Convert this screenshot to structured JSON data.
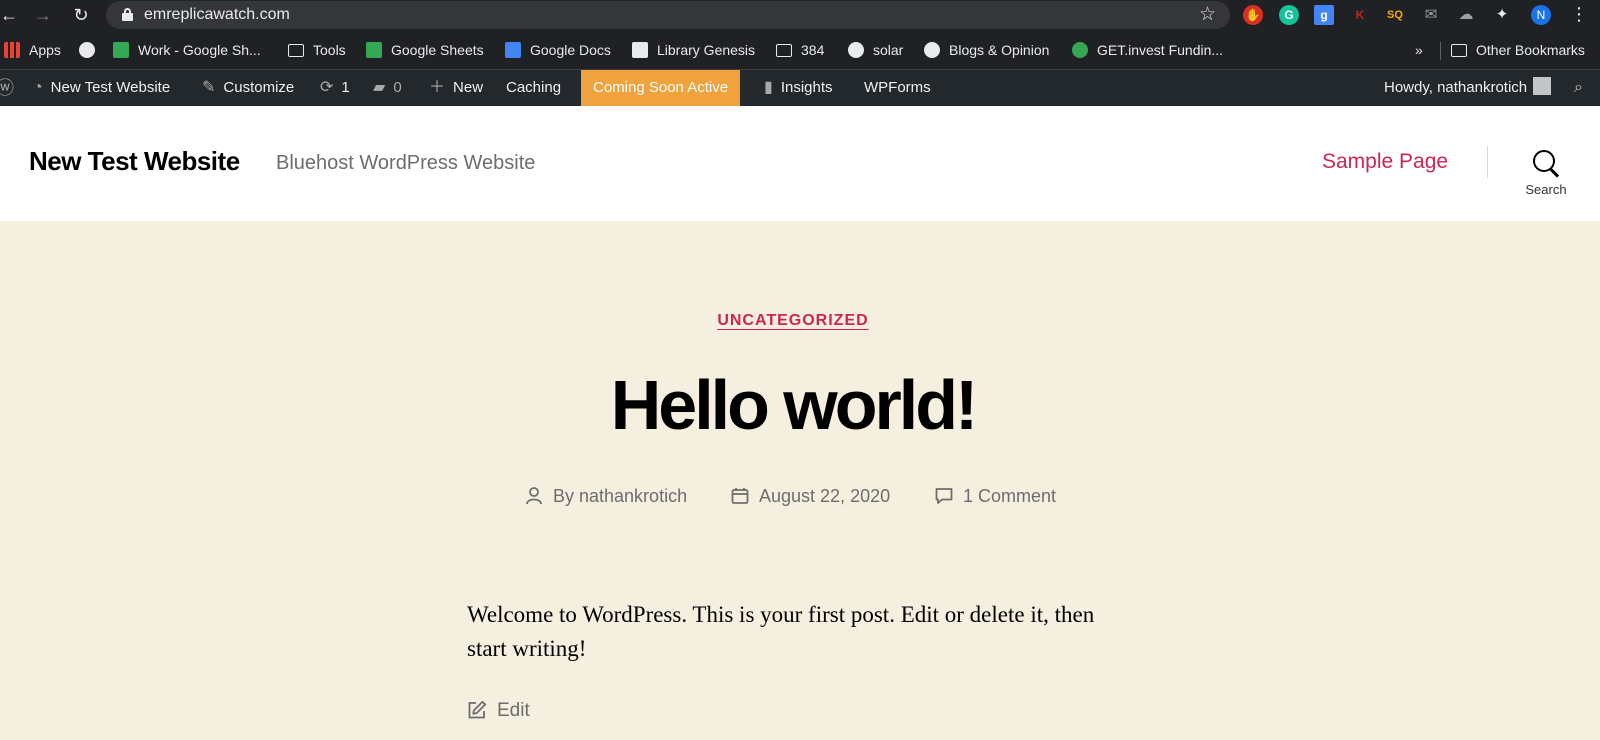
{
  "browser": {
    "url": "emreplicawatch.com",
    "bookmarks": [
      {
        "label": "Apps",
        "icon": "apps-grid-icon"
      },
      {
        "label": "",
        "icon": "globe-icon"
      },
      {
        "label": "Work - Google Sh...",
        "icon": "google-sheets-icon"
      },
      {
        "label": "Tools",
        "icon": "folder-icon"
      },
      {
        "label": "Google Sheets",
        "icon": "google-sheets-icon"
      },
      {
        "label": "Google Docs",
        "icon": "google-docs-icon"
      },
      {
        "label": "Library Genesis",
        "icon": "library-icon"
      },
      {
        "label": "384",
        "icon": "folder-icon"
      },
      {
        "label": "solar",
        "icon": "globe-icon"
      },
      {
        "label": "Blogs & Opinion",
        "icon": "globe-icon"
      },
      {
        "label": "GET.invest Fundin...",
        "icon": "getinvest-icon"
      }
    ],
    "overflow_label": "»",
    "other_bookmarks": "Other Bookmarks",
    "profile_initial": "N",
    "extension_letter_k": "K",
    "extension_letter_g": "G",
    "extension_label_sq": "SQ"
  },
  "adminbar": {
    "site_name": "New Test Website",
    "customize": "Customize",
    "updates_count": "1",
    "comments_count": "0",
    "new": "New",
    "caching": "Caching",
    "coming_soon": "Coming Soon Active",
    "insights": "Insights",
    "wpforms": "WPForms",
    "howdy": "Howdy, nathankrotich"
  },
  "site": {
    "title": "New Test Website",
    "description": "Bluehost WordPress Website",
    "nav_item": "Sample Page",
    "search_label": "Search"
  },
  "post": {
    "category": "UNCATEGORIZED",
    "title": "Hello world!",
    "author": "By nathankrotich",
    "date": "August 22, 2020",
    "comments": "1 Comment",
    "content": "Welcome to WordPress. This is your first post. Edit or delete it, then start writing!",
    "edit": "Edit"
  },
  "colors": {
    "accent": "#cd2653",
    "background": "#f5efe0",
    "admin_bar": "#23282d",
    "coming_soon": "#f0a23c"
  }
}
